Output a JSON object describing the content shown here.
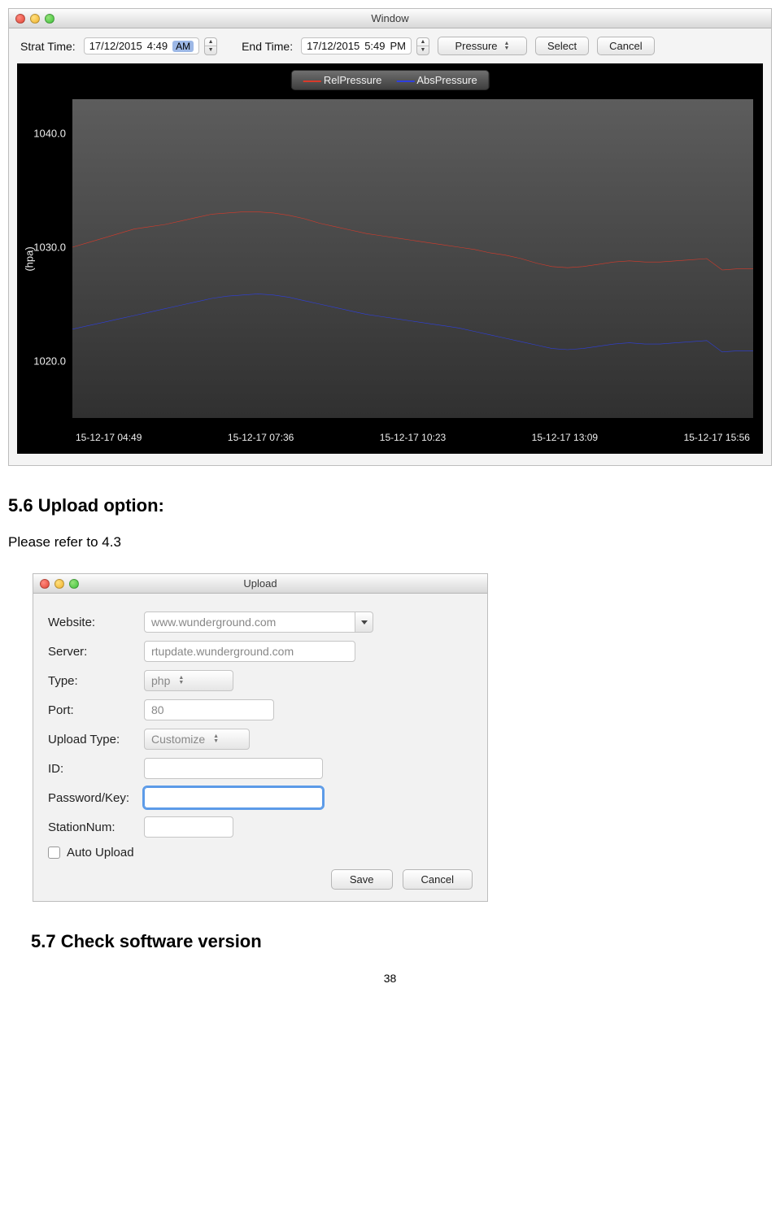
{
  "chartWindow": {
    "title": "Window",
    "toolbar": {
      "startLabel": "Strat Time:",
      "startDate": "17/12/2015",
      "startTime": "4:49",
      "startAmPm": "AM",
      "endLabel": "End Time:",
      "endDate": "17/12/2015",
      "endTime": "5:49",
      "endAmPm": "PM",
      "metric": "Pressure",
      "selectBtn": "Select",
      "cancelBtn": "Cancel"
    },
    "legend": {
      "rel": "RelPressure",
      "abs": "AbsPressure"
    },
    "yLabel": "(hpa)"
  },
  "chart_data": {
    "type": "line",
    "xlabel": "",
    "ylabel": "(hpa)",
    "ylim": [
      1015,
      1043
    ],
    "x_ticks": [
      "15-12-17 04:49",
      "15-12-17 07:36",
      "15-12-17 10:23",
      "15-12-17 13:09",
      "15-12-17 15:56"
    ],
    "y_ticks": [
      1020.0,
      1030.0,
      1040.0
    ],
    "series": [
      {
        "name": "RelPressure",
        "color": "#d83a2a",
        "values": [
          1030.0,
          1030.4,
          1030.8,
          1031.2,
          1031.6,
          1031.8,
          1032.0,
          1032.3,
          1032.6,
          1032.9,
          1033.0,
          1033.1,
          1033.1,
          1033.0,
          1032.8,
          1032.5,
          1032.1,
          1031.8,
          1031.5,
          1031.2,
          1031.0,
          1030.8,
          1030.6,
          1030.4,
          1030.2,
          1030.0,
          1029.8,
          1029.5,
          1029.3,
          1029.0,
          1028.6,
          1028.3,
          1028.2,
          1028.3,
          1028.5,
          1028.7,
          1028.8,
          1028.7,
          1028.7,
          1028.8,
          1028.9,
          1029.0,
          1028.0,
          1028.1,
          1028.1
        ]
      },
      {
        "name": "AbsPressure",
        "color": "#2e3fe0",
        "values": [
          1022.8,
          1023.1,
          1023.4,
          1023.7,
          1024.0,
          1024.3,
          1024.6,
          1024.9,
          1025.2,
          1025.5,
          1025.7,
          1025.8,
          1025.9,
          1025.8,
          1025.6,
          1025.3,
          1025.0,
          1024.7,
          1024.4,
          1024.1,
          1023.9,
          1023.7,
          1023.5,
          1023.3,
          1023.1,
          1022.9,
          1022.6,
          1022.3,
          1022.0,
          1021.7,
          1021.4,
          1021.1,
          1021.0,
          1021.1,
          1021.3,
          1021.5,
          1021.6,
          1021.5,
          1021.5,
          1021.6,
          1021.7,
          1021.8,
          1020.8,
          1020.9,
          1020.9
        ]
      }
    ]
  },
  "sections": {
    "s56": "5.6 Upload option:",
    "s56body": "Please refer to 4.3",
    "s57": "5.7 Check software version"
  },
  "uploadWindow": {
    "title": "Upload",
    "labels": {
      "website": "Website:",
      "server": "Server:",
      "type": "Type:",
      "port": "Port:",
      "uploadType": "Upload Type:",
      "id": "ID:",
      "password": "Password/Key:",
      "station": "StationNum:",
      "auto": "Auto Upload"
    },
    "values": {
      "website": "www.wunderground.com",
      "server": "rtupdate.wunderground.com",
      "type": "php",
      "port": "80",
      "uploadType": "Customize",
      "id": "",
      "password": "",
      "station": ""
    },
    "buttons": {
      "save": "Save",
      "cancel": "Cancel"
    }
  },
  "pageNumber": "38"
}
